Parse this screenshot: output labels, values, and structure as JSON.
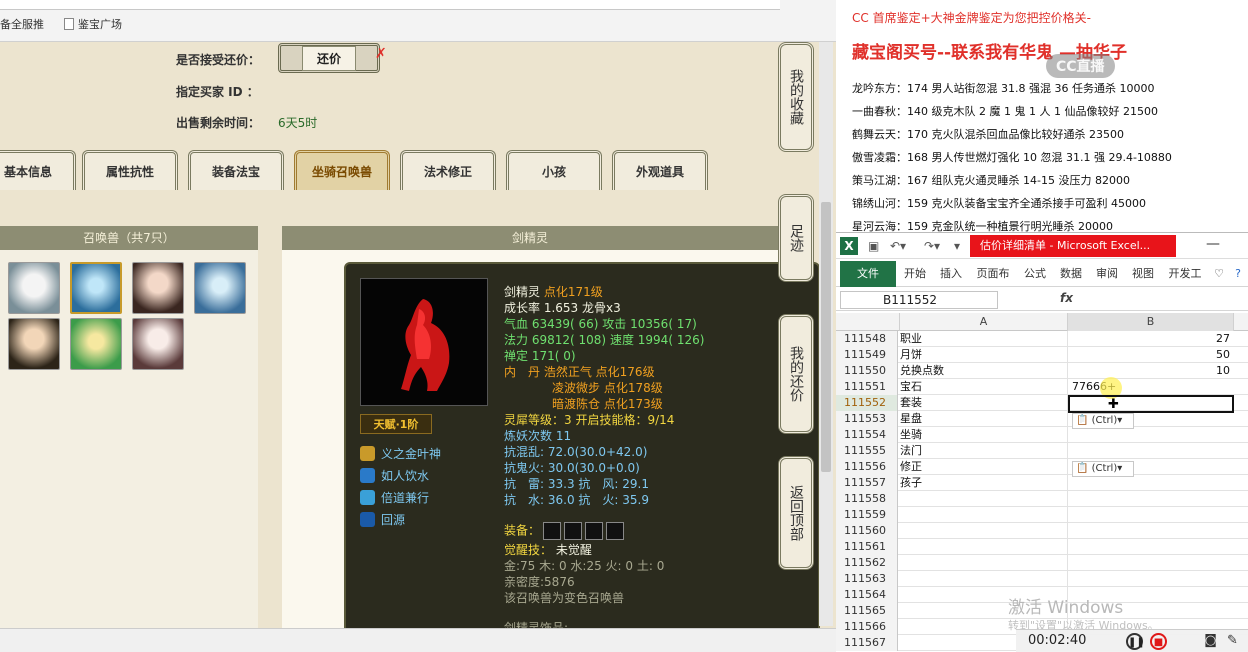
{
  "browser": {
    "bookmarks": [
      "备全服推",
      "鉴宝广场"
    ]
  },
  "trade": {
    "accept_counter_label": "是否接受还价：",
    "counter_button": "还价",
    "x_mark": "✗",
    "buyer_id_label": "指定买家 ID ：",
    "remaining_label": "出售剩余时间：",
    "remaining_value": "6天5时"
  },
  "tabs": [
    "基本信息",
    "属性抗性",
    "装备法宝",
    "坐骑召唤兽",
    "法术修正",
    "小孩",
    "外观道具"
  ],
  "pets": {
    "header": "召唤兽（共7只）"
  },
  "detail": {
    "header": "剑精灵",
    "name": "剑精灵",
    "refine": "点化171级",
    "growth": "成长率 1.653 龙骨x3",
    "hp_label": "气血",
    "hp_value": "63439( 66)",
    "atk_label": "攻击",
    "atk_value": "10356( 17)",
    "mp_label": "法力",
    "mp_value": "69812( 108)",
    "spd_label": "速度",
    "spd_value": "1994( 126)",
    "zen_label": "禅定",
    "zen_value": "171( 0)",
    "elixir_label": "内　丹",
    "elixir1": "浩然正气 点化176级",
    "elixir2": "凌波微步 点化178级",
    "elixir3": "暗渡陈仓 点化173级",
    "spirit_line": "灵犀等级：3 开启技能格：9/14",
    "demon_line": "炼妖次数 11",
    "res1": "抗混乱: 72.0(30.0+42.0)",
    "res2": "抗鬼火: 30.0(30.0+0.0)",
    "res3": "抗　雷: 33.3 抗　风: 29.1",
    "res4": "抗　水: 36.0 抗　火: 35.9",
    "equip_label": "装备：",
    "awaken_label": "觉醒技：",
    "awaken_value": "未觉醒",
    "elements": "金:75 木: 0 水:25 火: 0 土: 0",
    "intimacy": "亲密度:5876",
    "color_note": "该召唤兽为变色召唤兽",
    "ornament": "剑精灵饰品:",
    "talent": "天赋·1阶",
    "skills": [
      "义之金叶神",
      "如人饮水",
      "倍道兼行",
      "回源"
    ]
  },
  "side_nav": [
    {
      "label": "我的收藏"
    },
    {
      "label": "足迹"
    },
    {
      "label": "我的还价"
    },
    {
      "label": "返回顶部"
    }
  ],
  "notes": {
    "title1": "CC 首席鉴定+大神金牌鉴定为您把控价格关-",
    "title2": "藏宝阁买号--联系我有华鬼 —抽华子",
    "watermark": "CC直播",
    "lines": [
      "龙吟东方：174 男人站街忽混 31.8 强混 36 任务通杀 10000",
      "一曲春秋：140 级克木队 2 魔 1 鬼 1 人 1 仙品像较好 21500",
      "鹤舞云天：170 克火队混杀回血品像比较好通杀 23500",
      "傲雪凌霜：168 男人传世燃灯强化 10 忽混 31.1 强 29.4-10880",
      "策马江湖：167 组队克火通灵睡杀 14-15 没压力 82000",
      "锦绣山河：159 克火队装备宝宝齐全通杀接手可盈利 45000",
      "星河云海：159 克金队统一种植景行明光睡杀 20000"
    ]
  },
  "excel": {
    "doc_title": "估价详细清单 - Microsoft Excel...",
    "ribbon_tabs": [
      "文件",
      "开始",
      "插入",
      "页面布",
      "公式",
      "数据",
      "审阅",
      "视图",
      "开发工"
    ],
    "name_box": "B111552",
    "fx": "fx",
    "col_a": "A",
    "col_b": "B",
    "rows": [
      {
        "n": "111548",
        "a": "职业",
        "b": "27"
      },
      {
        "n": "111549",
        "a": "月饼",
        "b": "50"
      },
      {
        "n": "111550",
        "a": "兑换点数",
        "b": "10"
      },
      {
        "n": "111551",
        "a": "宝石",
        "b": "77666+"
      },
      {
        "n": "111552",
        "a": "套装",
        "b": ""
      },
      {
        "n": "111553",
        "a": "星盘",
        "b": ""
      },
      {
        "n": "111554",
        "a": "坐骑",
        "b": ""
      },
      {
        "n": "111555",
        "a": "法门",
        "b": ""
      },
      {
        "n": "111556",
        "a": "修正",
        "b": ""
      },
      {
        "n": "111557",
        "a": "孩子",
        "b": ""
      },
      {
        "n": "111558",
        "a": "",
        "b": ""
      },
      {
        "n": "111559",
        "a": "",
        "b": ""
      },
      {
        "n": "111560",
        "a": "",
        "b": ""
      },
      {
        "n": "111561",
        "a": "",
        "b": ""
      },
      {
        "n": "111562",
        "a": "",
        "b": ""
      },
      {
        "n": "111563",
        "a": "",
        "b": ""
      },
      {
        "n": "111564",
        "a": "",
        "b": ""
      },
      {
        "n": "111565",
        "a": "",
        "b": ""
      },
      {
        "n": "111566",
        "a": "",
        "b": ""
      },
      {
        "n": "111567",
        "a": "",
        "b": ""
      }
    ],
    "paste_tag": "(Ctrl)",
    "activate1": "激活 Windows",
    "activate2": "转到\"设置\"以激活 Windows。",
    "rec_time": "00:02:40"
  },
  "colors": {
    "accent_green": "#217346",
    "excel_title_red": "#e8141a",
    "note_red": "#e0302a",
    "tooltip_bg": "#2b2b1e"
  }
}
